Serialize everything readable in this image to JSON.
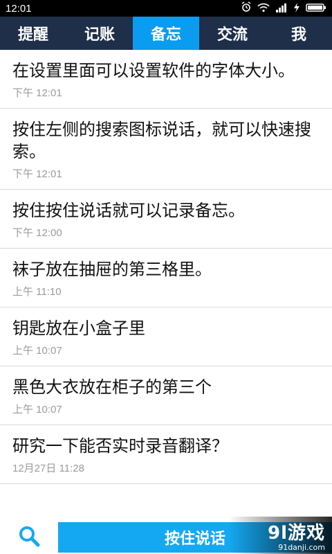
{
  "status": {
    "time": "12:01"
  },
  "tabs": [
    {
      "label": "提醒"
    },
    {
      "label": "记账"
    },
    {
      "label": "备忘",
      "active": true
    },
    {
      "label": "交流"
    },
    {
      "label": "我"
    }
  ],
  "notes": [
    {
      "text": "在设置里面可以设置软件的字体大小。",
      "time": "下午 12:01"
    },
    {
      "text": "按住左侧的搜索图标说话，就可以快速搜索。",
      "time": "下午 12:01"
    },
    {
      "text": "按住按住说话就可以记录备忘。",
      "time": "下午 12:00"
    },
    {
      "text": "袜子放在抽屉的第三格里。",
      "time": "上午 11:10"
    },
    {
      "text": "钥匙放在小盒子里",
      "time": "上午 10:07"
    },
    {
      "text": "黑色大衣放在柜子的第三个",
      "time": "上午 10:07"
    },
    {
      "text": "研究一下能否实时录音翻译？",
      "time": "12月27日 11:28"
    }
  ],
  "bottom": {
    "talk_label": "按住说话"
  },
  "watermark": {
    "big": "9l游戏",
    "small": "91danji.com"
  },
  "colors": {
    "tab_bg": "#1f2f4a",
    "tab_active": "#0a9cf0",
    "button_blue": "#15a8f2"
  },
  "icons": [
    "alarm-icon",
    "wifi-icon",
    "signal-icon",
    "lightning-icon",
    "battery-icon",
    "search-icon"
  ]
}
